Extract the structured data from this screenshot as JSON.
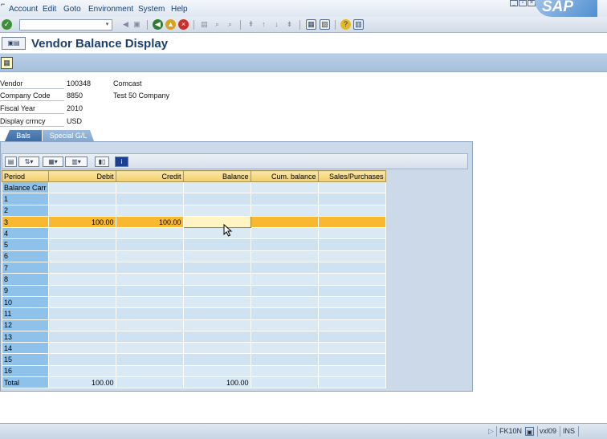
{
  "menu": {
    "items": [
      "Account",
      "Edit",
      "Goto",
      "Environment",
      "System",
      "Help"
    ]
  },
  "brand": {
    "logo_text": "SAP"
  },
  "toolbar": {
    "command_value": ""
  },
  "title": {
    "text": "Vendor Balance Display"
  },
  "header_fields": [
    {
      "label": "Vendor",
      "value": "100348",
      "desc": "Comcast"
    },
    {
      "label": "Company Code",
      "value": "8850",
      "desc": "Test 50 Company"
    },
    {
      "label": "Fiscal Year",
      "value": "2010",
      "desc": ""
    },
    {
      "label": "Display crrncy",
      "value": "USD",
      "desc": ""
    }
  ],
  "tabs": [
    {
      "label": "Bals",
      "active": true
    },
    {
      "label": "Special G/L",
      "active": false
    }
  ],
  "table": {
    "columns": [
      "Period",
      "Debit",
      "Credit",
      "Balance",
      "Cum. balance",
      "Sales/Purchases"
    ],
    "rows": [
      [
        "Balance Carr",
        "",
        "",
        "",
        "",
        ""
      ],
      [
        "1",
        "",
        "",
        "",
        "",
        ""
      ],
      [
        "2",
        "",
        "",
        "",
        "",
        ""
      ],
      [
        "3",
        "100.00",
        "100.00",
        "",
        "",
        ""
      ],
      [
        "4",
        "",
        "",
        "",
        "",
        ""
      ],
      [
        "5",
        "",
        "",
        "",
        "",
        ""
      ],
      [
        "6",
        "",
        "",
        "",
        "",
        ""
      ],
      [
        "7",
        "",
        "",
        "",
        "",
        ""
      ],
      [
        "8",
        "",
        "",
        "",
        "",
        ""
      ],
      [
        "9",
        "",
        "",
        "",
        "",
        ""
      ],
      [
        "10",
        "",
        "",
        "",
        "",
        ""
      ],
      [
        "11",
        "",
        "",
        "",
        "",
        ""
      ],
      [
        "12",
        "",
        "",
        "",
        "",
        ""
      ],
      [
        "13",
        "",
        "",
        "",
        "",
        ""
      ],
      [
        "14",
        "",
        "",
        "",
        "",
        ""
      ],
      [
        "15",
        "",
        "",
        "",
        "",
        ""
      ],
      [
        "16",
        "",
        "",
        "",
        "",
        ""
      ],
      [
        "Total",
        "100.00",
        "",
        "100.00",
        "",
        ""
      ]
    ],
    "selected_row": 3
  },
  "status": {
    "transaction": "FK10N",
    "server": "vxl09",
    "mode": "INS"
  },
  "colors": {
    "header_blue": "#1d3f6e",
    "selected_row": "#f8b830",
    "period_column": "#8ec2ea"
  }
}
